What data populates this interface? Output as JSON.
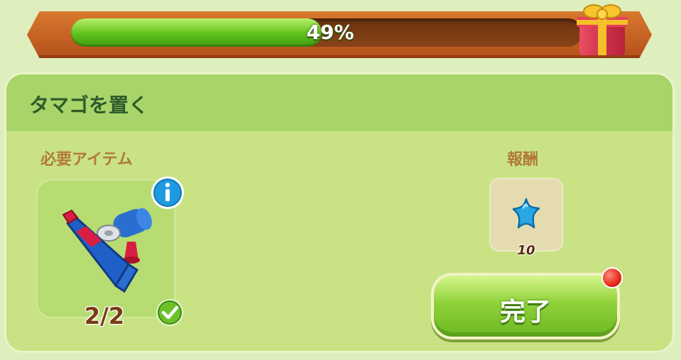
{
  "progress": {
    "value": 0.49,
    "label": "49%",
    "reward_icon": "gift-box-icon"
  },
  "quest": {
    "title": "タマゴを置く",
    "required_items_label": "必要アイテム",
    "reward_label": "報酬",
    "item": {
      "icon": "glue-tube-tools-icon",
      "count": "2/2",
      "completed": true
    },
    "reward": {
      "icon": "blue-star-icon",
      "amount": "10"
    },
    "complete_button_label": "完了"
  },
  "colors": {
    "accent_green": "#6cb822",
    "progress_fill": "#5fc21c",
    "title_green": "#2f5b2a",
    "label_brown": "#b27a36",
    "notification_red": "#e8281a"
  }
}
